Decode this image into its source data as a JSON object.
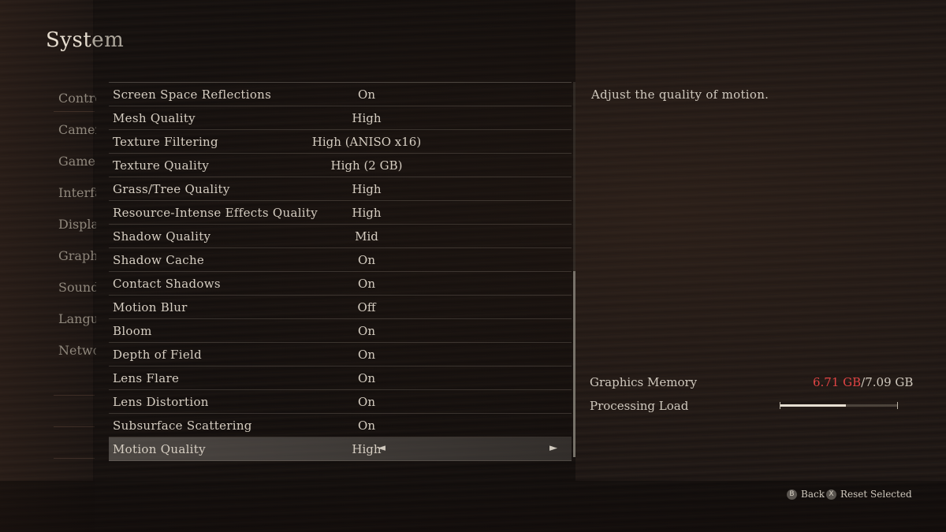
{
  "page": {
    "title": "System"
  },
  "categories": [
    "Controls",
    "Camera",
    "Game",
    "Interface",
    "Display",
    "Graphics",
    "Sound",
    "Language",
    "Network"
  ],
  "settings": [
    {
      "label": "Screen Space Reflections",
      "value": "On"
    },
    {
      "label": "Mesh Quality",
      "value": "High"
    },
    {
      "label": "Texture Filtering",
      "value": "High (ANISO x16)"
    },
    {
      "label": "Texture Quality",
      "value": "High (2 GB)"
    },
    {
      "label": "Grass/Tree Quality",
      "value": "High"
    },
    {
      "label": "Resource-Intense Effects Quality",
      "value": "High"
    },
    {
      "label": "Shadow Quality",
      "value": "Mid"
    },
    {
      "label": "Shadow Cache",
      "value": "On"
    },
    {
      "label": "Contact Shadows",
      "value": "On"
    },
    {
      "label": "Motion Blur",
      "value": "Off"
    },
    {
      "label": "Bloom",
      "value": "On"
    },
    {
      "label": "Depth of Field",
      "value": "On"
    },
    {
      "label": "Lens Flare",
      "value": "On"
    },
    {
      "label": "Lens Distortion",
      "value": "On"
    },
    {
      "label": "Subsurface Scattering",
      "value": "On"
    },
    {
      "label": "Motion Quality",
      "value": "High"
    }
  ],
  "arrows": {
    "left": "◄",
    "right": "►"
  },
  "description": "Adjust the quality of motion.",
  "stats": {
    "graphics_memory_label": "Graphics Memory",
    "graphics_memory_used": "6.71 GB",
    "graphics_memory_total": "/7.09 GB",
    "processing_load_label": "Processing Load",
    "processing_load_fraction": 0.56
  },
  "hints": {
    "back_button": "B",
    "back_label": "Back",
    "reset_button": "X",
    "reset_label": "Reset Selected"
  },
  "colors": {
    "memory_used": "#e04444",
    "selected_row": "#78736e"
  }
}
